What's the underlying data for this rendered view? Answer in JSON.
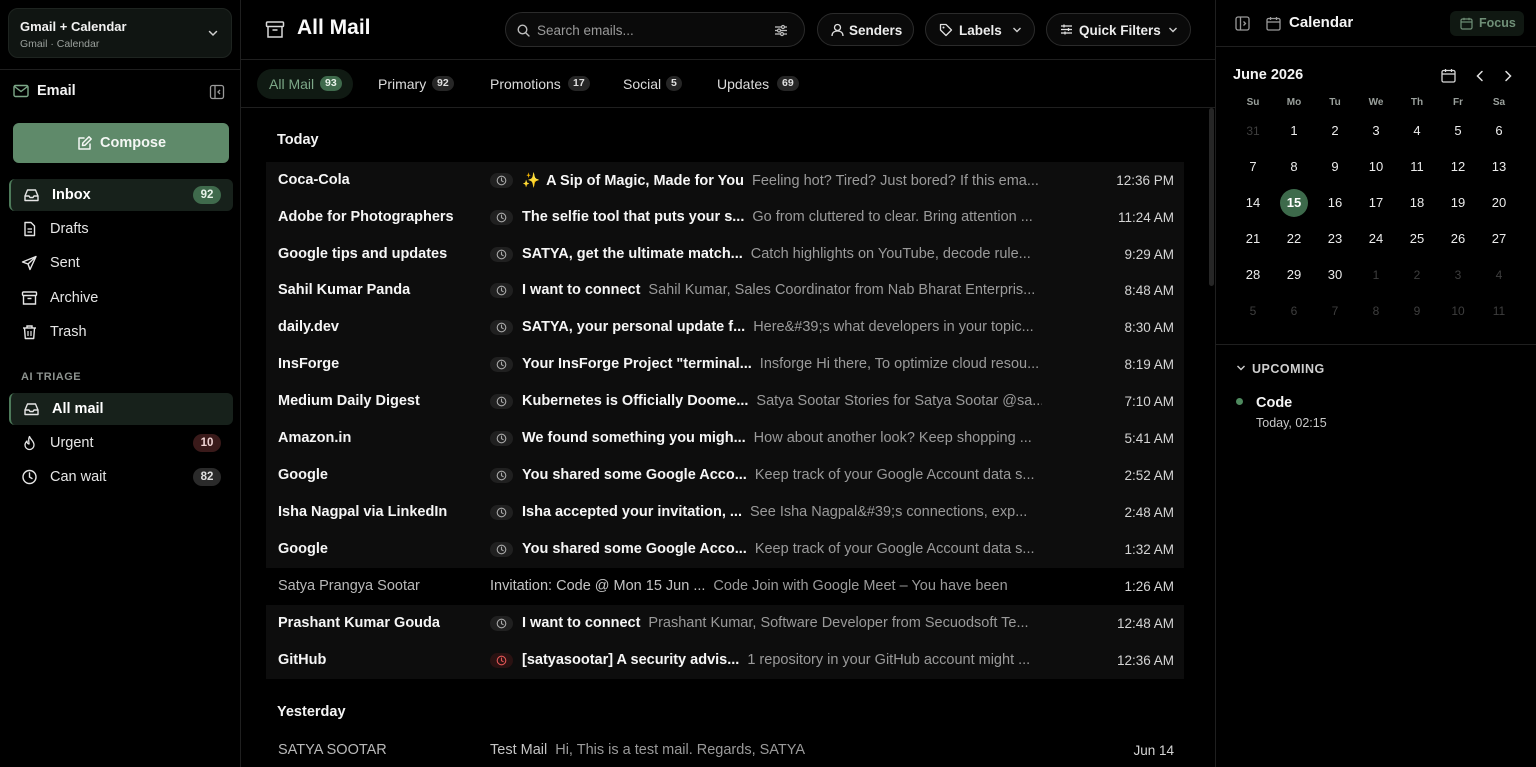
{
  "account": {
    "name": "Gmail + Calendar",
    "subtitle": "Gmail · Calendar"
  },
  "sidebar": {
    "section_title": "Email",
    "compose_label": "Compose",
    "items": [
      {
        "label": "Inbox",
        "count": "92",
        "icon": "inbox-icon",
        "active": true
      },
      {
        "label": "Drafts",
        "icon": "document-icon"
      },
      {
        "label": "Sent",
        "icon": "send-icon"
      },
      {
        "label": "Archive",
        "icon": "archive-icon"
      },
      {
        "label": "Trash",
        "icon": "trash-icon"
      }
    ],
    "ai_triage_label": "AI TRIAGE",
    "triage": [
      {
        "label": "All mail",
        "icon": "inbox-icon",
        "active": true
      },
      {
        "label": "Urgent",
        "count": "10",
        "icon": "flame-icon"
      },
      {
        "label": "Can wait",
        "count": "82",
        "icon": "clock-icon"
      }
    ]
  },
  "header": {
    "title": "All Mail",
    "search_placeholder": "Search emails...",
    "senders_label": "Senders",
    "labels_label": "Labels",
    "quick_filters_label": "Quick Filters"
  },
  "tabs": [
    {
      "label": "All Mail",
      "count": "93",
      "active": true
    },
    {
      "label": "Primary",
      "count": "92"
    },
    {
      "label": "Promotions",
      "count": "17"
    },
    {
      "label": "Social",
      "count": "5"
    },
    {
      "label": "Updates",
      "count": "69"
    }
  ],
  "groups": [
    {
      "label": "Today",
      "emails": [
        {
          "sender": "Coca-Cola",
          "subject": "A Sip of Magic, Made for You",
          "preview": "Feeling hot? Tired? Just bored? If this ema...",
          "time": "12:36 PM",
          "unread": true,
          "sparkle": "✨"
        },
        {
          "sender": "Adobe for Photographers",
          "subject": "The selfie tool that puts your s...",
          "preview": "Go from cluttered to clear. Bring attention ...",
          "time": "11:24 AM",
          "unread": true
        },
        {
          "sender": "Google tips and updates",
          "subject": "SATYA, get the ultimate match...",
          "preview": "Catch highlights on YouTube, decode rule...",
          "time": "9:29 AM",
          "unread": true
        },
        {
          "sender": "Sahil Kumar Panda",
          "subject": "I want to connect",
          "preview": "Sahil Kumar, Sales Coordinator from Nab Bharat Enterpris...",
          "time": "8:48 AM",
          "unread": true
        },
        {
          "sender": "daily.dev",
          "subject": "SATYA, your personal update f...",
          "preview": "Here&#39;s what developers in your topic...",
          "time": "8:30 AM",
          "unread": true
        },
        {
          "sender": "InsForge",
          "subject": "Your InsForge Project \"terminal...",
          "preview": "Insforge Hi there, To optimize cloud resou...",
          "time": "8:19 AM",
          "unread": true
        },
        {
          "sender": "Medium Daily Digest",
          "subject": "Kubernetes is Officially Doome...",
          "preview": "Satya Sootar Stories for Satya Sootar @sa...",
          "time": "7:10 AM",
          "unread": true
        },
        {
          "sender": "Amazon.in",
          "subject": "We found something you migh...",
          "preview": "How about another look? Keep shopping ...",
          "time": "5:41 AM",
          "unread": true
        },
        {
          "sender": "Google",
          "subject": "You shared some Google Acco...",
          "preview": "Keep track of your Google Account data s...",
          "time": "2:52 AM",
          "unread": true
        },
        {
          "sender": "Isha Nagpal via LinkedIn",
          "subject": "Isha accepted your invitation, ...",
          "preview": "See Isha Nagpal&#39;s connections, exp...",
          "time": "2:48 AM",
          "unread": true
        },
        {
          "sender": "Google",
          "subject": "You shared some Google Acco...",
          "preview": "Keep track of your Google Account data s...",
          "time": "1:32 AM",
          "unread": true
        },
        {
          "sender": "Satya Prangya Sootar",
          "subject": "Invitation: Code @ Mon 15 Jun ...",
          "preview": "Code Join with Google Meet – You have been i...",
          "time": "1:26 AM",
          "unread": false
        },
        {
          "sender": "Prashant Kumar Gouda",
          "subject": "I want to connect",
          "preview": "Prashant Kumar, Software Developer from Secuodsoft Te...",
          "time": "12:48 AM",
          "unread": true
        },
        {
          "sender": "GitHub",
          "subject": "[satyasootar] A security advis...",
          "preview": "1 repository in your GitHub account might ...",
          "time": "12:36 AM",
          "unread": true,
          "alert": true
        }
      ]
    },
    {
      "label": "Yesterday",
      "emails": [
        {
          "sender": "SATYA SOOTAR",
          "subject": "Test Mail",
          "preview": "Hi, This is a test mail. Regards, SATYA",
          "time": "Jun 14",
          "unread": false
        }
      ]
    }
  ],
  "calendar": {
    "title": "Calendar",
    "focus_label": "Focus",
    "month_label": "June 2026",
    "weekdays": [
      "Su",
      "Mo",
      "Tu",
      "We",
      "Th",
      "Fr",
      "Sa"
    ],
    "weeks": [
      [
        "31",
        "1",
        "2",
        "3",
        "4",
        "5",
        "6"
      ],
      [
        "7",
        "8",
        "9",
        "10",
        "11",
        "12",
        "13"
      ],
      [
        "14",
        "15",
        "16",
        "17",
        "18",
        "19",
        "20"
      ],
      [
        "21",
        "22",
        "23",
        "24",
        "25",
        "26",
        "27"
      ],
      [
        "28",
        "29",
        "30",
        "1",
        "2",
        "3",
        "4"
      ],
      [
        "5",
        "6",
        "7",
        "8",
        "9",
        "10",
        "11"
      ]
    ],
    "selected_day": "15",
    "upcoming_label": "UPCOMING",
    "events": [
      {
        "title": "Code",
        "time": "Today, 02:15"
      }
    ]
  },
  "colors": {
    "accent": "#5f8a6a",
    "selected_day": "#3d6a4b",
    "urgent_badge": "#3a1a1a",
    "alert_icon": "#e05555"
  }
}
